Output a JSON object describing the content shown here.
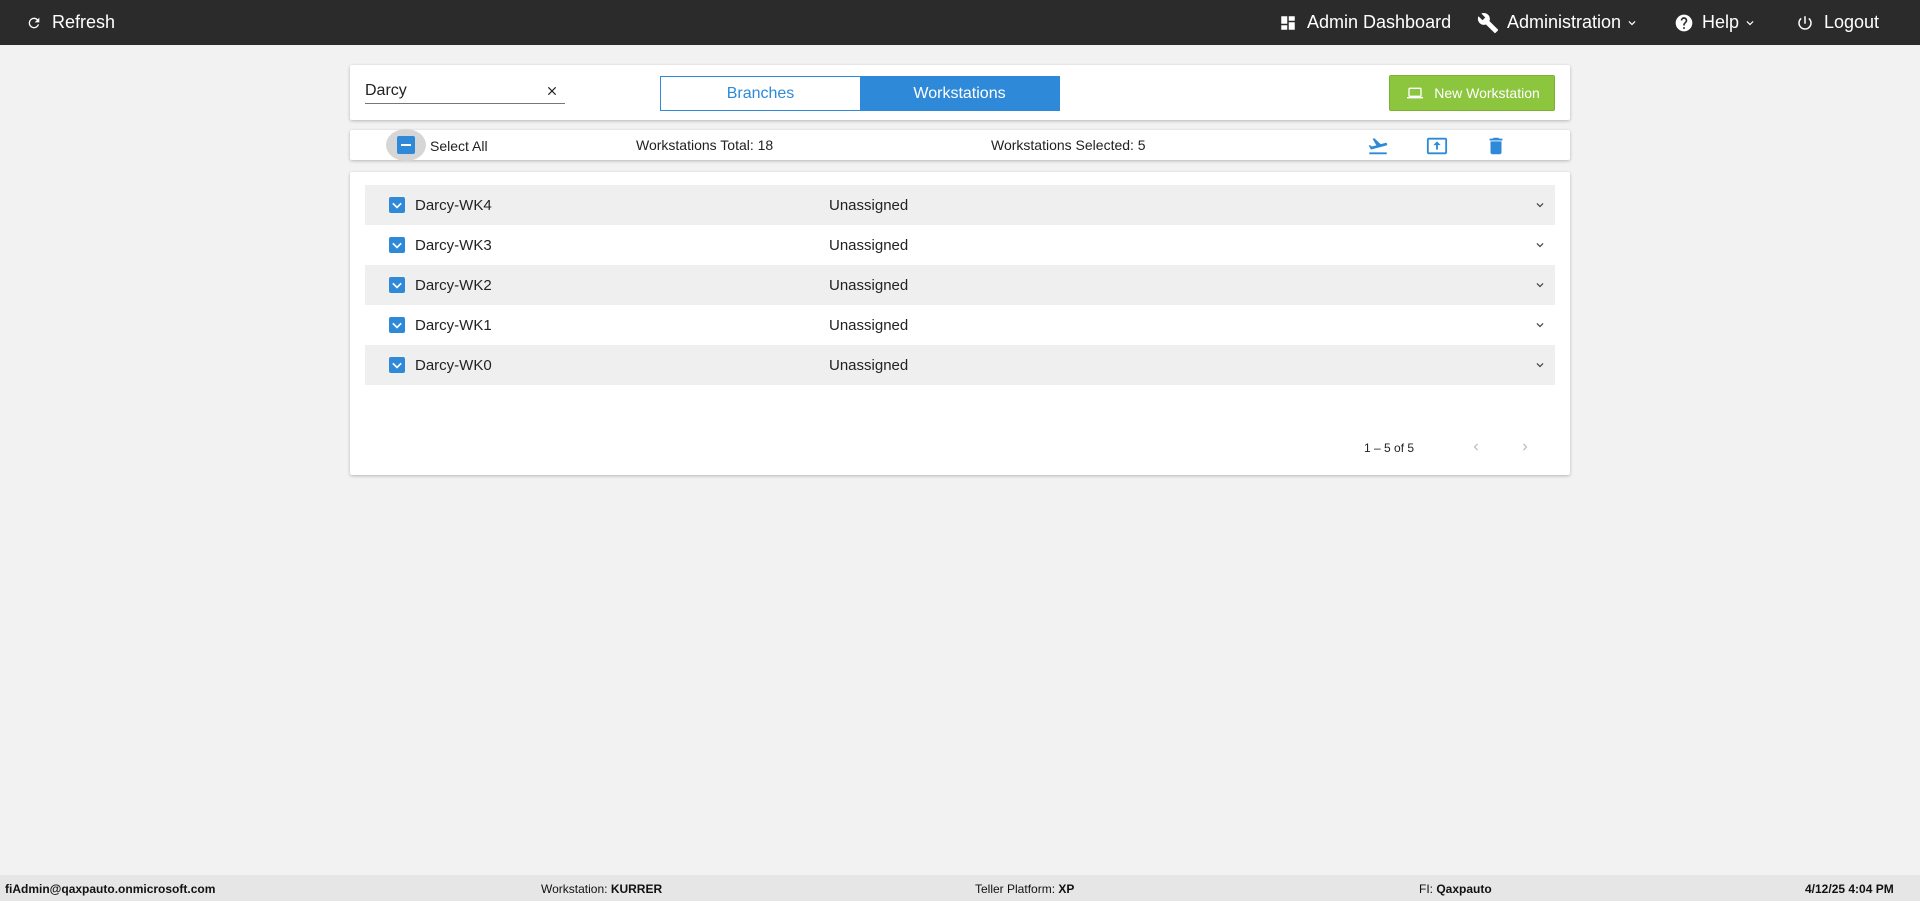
{
  "topbar": {
    "refresh_label": "Refresh",
    "admin_dashboard_label": "Admin Dashboard",
    "administration_label": "Administration",
    "help_label": "Help",
    "logout_label": "Logout"
  },
  "search": {
    "value": "Darcy",
    "placeholder": ""
  },
  "view_toggle": {
    "branches_label": "Branches",
    "workstations_label": "Workstations",
    "active": "Workstations"
  },
  "new_workstation_label": "New Workstation",
  "action_bar": {
    "select_all_label": "Select All",
    "total_label": "Workstations Total: 18",
    "selected_label": "Workstations Selected: 5"
  },
  "rows": [
    {
      "name": "Darcy-WK4",
      "status": "Unassigned"
    },
    {
      "name": "Darcy-WK3",
      "status": "Unassigned"
    },
    {
      "name": "Darcy-WK2",
      "status": "Unassigned"
    },
    {
      "name": "Darcy-WK1",
      "status": "Unassigned"
    },
    {
      "name": "Darcy-WK0",
      "status": "Unassigned"
    }
  ],
  "pagination": {
    "range_label": "1 – 5 of 5"
  },
  "footer": {
    "user": "fiAdmin@qaxpauto.onmicrosoft.com",
    "workstation_label": "Workstation:",
    "workstation_value": "KURRER",
    "teller_platform_label": "Teller Platform:",
    "teller_platform_value": "XP",
    "fi_label": "FI:",
    "fi_value": "Qaxpauto",
    "datetime": "4/12/25 4:04 PM"
  },
  "colors": {
    "topbar_bg": "#2b2b2b",
    "accent_blue": "#2e8ad8",
    "new_button_green": "#8cc63f",
    "page_bg": "#f2f2f2"
  }
}
